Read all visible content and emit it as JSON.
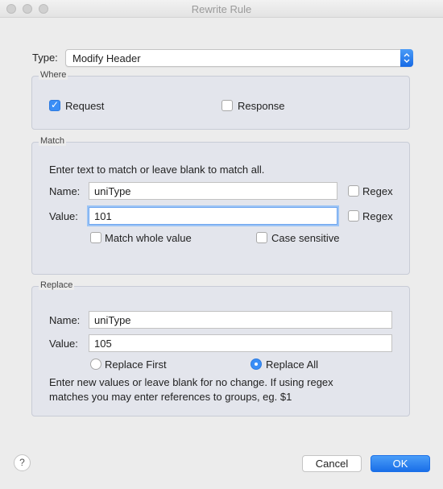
{
  "window": {
    "title": "Rewrite Rule"
  },
  "type": {
    "label": "Type:",
    "value": "Modify Header"
  },
  "where": {
    "title": "Where",
    "request": {
      "label": "Request",
      "checked": true
    },
    "response": {
      "label": "Response",
      "checked": false
    }
  },
  "match": {
    "title": "Match",
    "instruction": "Enter text to match or leave blank to match all.",
    "name_label": "Name:",
    "name_value": "uniType",
    "name_regex_label": "Regex",
    "value_label": "Value:",
    "value_value": "101",
    "value_regex_label": "Regex",
    "whole_value_label": "Match whole value",
    "case_sensitive_label": "Case sensitive"
  },
  "replace": {
    "title": "Replace",
    "name_label": "Name:",
    "name_value": "uniType",
    "value_label": "Value:",
    "value_value": "105",
    "replace_first_label": "Replace First",
    "replace_all_label": "Replace All",
    "selected_option": "Replace All",
    "note_line1": "Enter new values or leave blank for no change. If using regex",
    "note_line2": "matches you may enter references to groups, eg. $1"
  },
  "footer": {
    "help_label": "?",
    "cancel_label": "Cancel",
    "ok_label": "OK"
  },
  "colors": {
    "accent": "#3a8ef6",
    "group_bg": "#e3e5ec",
    "window_bg": "#ececec"
  }
}
